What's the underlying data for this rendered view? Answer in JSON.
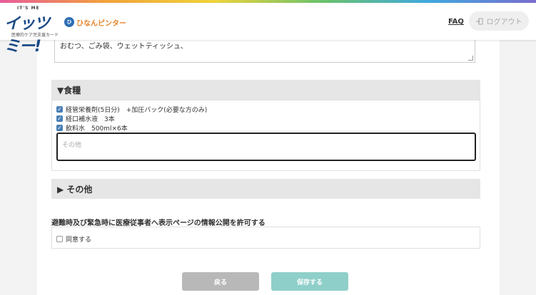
{
  "header": {
    "logo_tag": "IT'S ME",
    "logo_main": "イッツミー!",
    "logo_sub": "医療的ケア児支援カード",
    "partner_mark": "ひ",
    "partner_name": "ひなんピンター",
    "faq_label": "FAQ",
    "logout_label": "ログアウト"
  },
  "top_textarea": {
    "value": "おむつ、ごみ袋、ウェットティッシュ、"
  },
  "food_section": {
    "title": "▼食糧",
    "items": [
      {
        "label": "経管栄養剤(5日分)　+加圧バック(必要な方のみ)",
        "checked": true
      },
      {
        "label": "経口補水液　3本",
        "checked": true
      },
      {
        "label": "飲料水　500ml×6本",
        "checked": true
      }
    ],
    "other_placeholder": "その他"
  },
  "other_section": {
    "title": "▶ その他"
  },
  "consent": {
    "title": "避難時及び緊急時に医療従事者へ表示ページの情報公開を許可する",
    "checkbox_label": "同意する",
    "checked": false
  },
  "buttons": {
    "back": "戻る",
    "save": "保存する"
  },
  "colors": {
    "checkbox": "#4a7fb5",
    "save_button": "#8fcfc9",
    "back_button": "#b8b8b8"
  }
}
